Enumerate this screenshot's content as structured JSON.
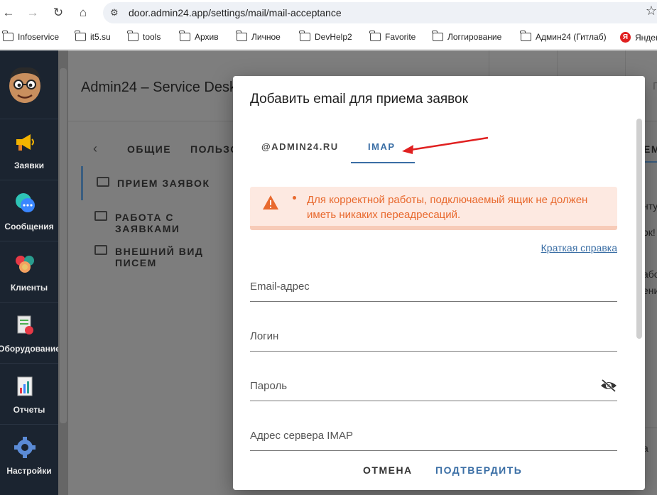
{
  "browser": {
    "url": "door.admin24.app/settings/mail/mail-acceptance",
    "bookmarks": [
      "Infoservice",
      "it5.su",
      "tools",
      "Архив",
      "Личное",
      "DevHelp2",
      "Favorite",
      "Логгирование",
      "Админ24 (Гитлаб)",
      "Яндекс"
    ]
  },
  "sidebar": {
    "items": [
      {
        "label": "Заявки",
        "icon": "megaphone-icon"
      },
      {
        "label": "Сообщения",
        "icon": "chat-icon"
      },
      {
        "label": "Клиенты",
        "icon": "clients-icon"
      },
      {
        "label": "Оборудование",
        "icon": "equipment-icon"
      },
      {
        "label": "Отчеты",
        "icon": "reports-icon"
      },
      {
        "label": "Настройки",
        "icon": "gear-icon"
      }
    ]
  },
  "header": {
    "title": "Admin24 – Service Desk",
    "right_fragment": "П"
  },
  "settings_tabs": {
    "general": "ОБЩИЕ",
    "users": "ПОЛЬЗО",
    "right": "ЕМ"
  },
  "submenu": {
    "items": [
      {
        "label": "ПРИЕМ ЗАЯВОК"
      },
      {
        "label": "РАБОТА С ЗАЯВКАМИ"
      },
      {
        "label": "ВНЕШНИЙ ВИД ПИСЕМ"
      }
    ]
  },
  "bg_right": {
    "lines": [
      "нту",
      "ок!",
      "або",
      "ени",
      "а"
    ]
  },
  "dialog": {
    "title": "Добавить email для приема заявок",
    "tabs": [
      "@ADMIN24.RU",
      "IMAP"
    ],
    "active_tab": "IMAP",
    "alert": "Для корректной работы, подключаемый ящик не должен иметь никаких переадресаций.",
    "help_link": "Краткая справка",
    "fields": {
      "email": "Email-адрес",
      "login": "Логин",
      "password": "Пароль",
      "imap_server": "Адрес сервера IMAP"
    },
    "cancel": "ОТМЕНА",
    "confirm": "ПОДТВЕРДИТЬ"
  },
  "colors": {
    "accent": "#3a6ea5",
    "warning": "#e8692e",
    "sidebar": "#1b2430",
    "arrow": "#e02020"
  }
}
